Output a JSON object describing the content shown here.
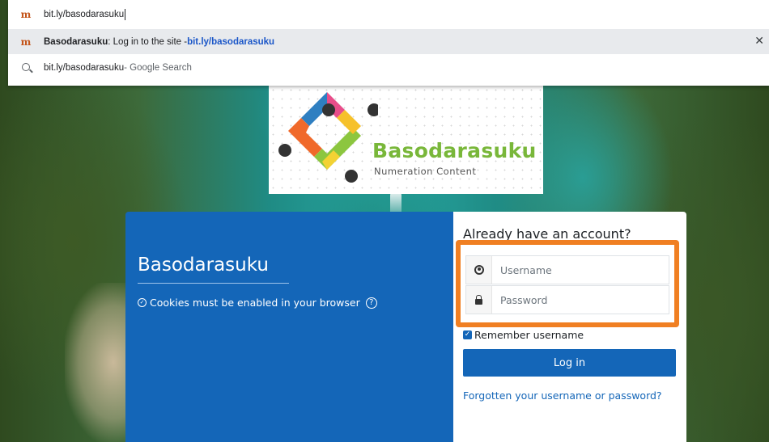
{
  "omnibox": {
    "input_text": "bit.ly/basodarasuku",
    "suggestions": [
      {
        "title": "Basodarasuku",
        "description": ": Log in to the site - ",
        "url": "bit.ly/basodarasuku",
        "icon": "moodle-favicon"
      },
      {
        "text": "bit.ly/basodarasuku",
        "suffix": " - Google Search",
        "icon": "search-icon"
      }
    ],
    "close_label": "✕"
  },
  "logo": {
    "title": "Basodarasuku",
    "subtitle": "Numeration Content"
  },
  "login": {
    "site_name": "Basodarasuku",
    "cookie_notice": "Cookies must be enabled in your browser",
    "heading": "Already have an account?",
    "username_placeholder": "Username",
    "password_placeholder": "Password",
    "remember_label": "Remember username",
    "login_button": "Log in",
    "forgot_link": "Forgotten your username or password?"
  },
  "colors": {
    "brand_blue": "#1466b8",
    "highlight_orange": "#f07f22",
    "logo_green": "#79b73a"
  }
}
